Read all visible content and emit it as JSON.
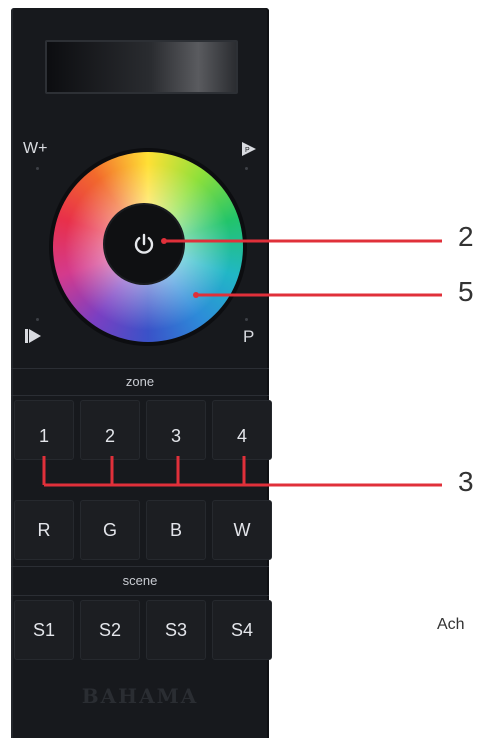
{
  "remote": {
    "top_left_label": "W+",
    "bottom_left_label": "▶",
    "bottom_right_label": "P",
    "zone_label": "zone",
    "zone_buttons": [
      "1",
      "2",
      "3",
      "4"
    ],
    "color_buttons": [
      "R",
      "G",
      "B",
      "W"
    ],
    "scene_label": "scene",
    "scene_buttons": [
      "S1",
      "S2",
      "S3",
      "S4"
    ],
    "brand": "BAHAMA"
  },
  "callouts": [
    "2",
    "5",
    "3"
  ],
  "side_text": "Ach",
  "colors": {
    "callout_line": "#e0303a",
    "remote_body": "#17191d"
  }
}
